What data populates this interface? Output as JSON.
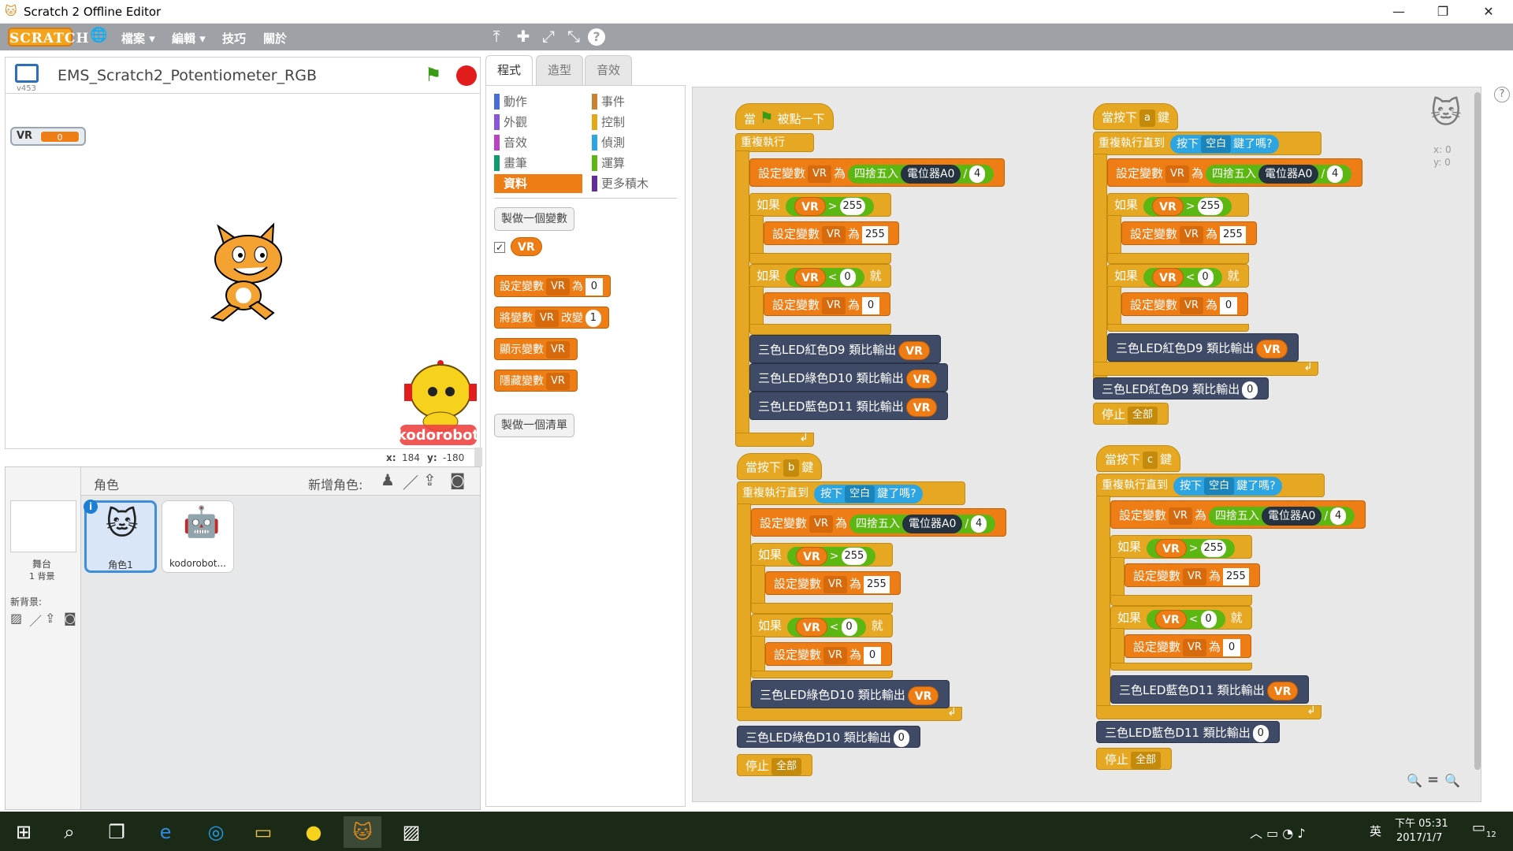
{
  "window": {
    "title": "Scratch 2 Offline Editor",
    "minimize": "—",
    "restore": "❐",
    "close": "✕"
  },
  "menu": {
    "logo": "SCRATCH",
    "globe": "🌐",
    "items": [
      "檔案 ▾",
      "編輯 ▾",
      "技巧",
      "關於"
    ]
  },
  "toolbar": {
    "duplicate": "⤒",
    "delete": "✚",
    "grow": "⤢",
    "shrink": "⤡",
    "help": "?"
  },
  "stage": {
    "project_title": "EMS_Scratch2_Potentiometer_RGB",
    "version": "v453",
    "readout_label": "VR",
    "readout_value": "0",
    "x_label": "x:",
    "x_value": "184",
    "y_label": "y:",
    "y_value": "-180"
  },
  "sprites": {
    "header": "角色",
    "new_sprite_label": "新增角色:",
    "stage_label": "舞台",
    "stage_backdrops": "1 背景",
    "new_backdrop_label": "新背景:",
    "items": [
      {
        "name": "角色1"
      },
      {
        "name": "kodorobot..."
      }
    ]
  },
  "tabs": [
    "程式",
    "造型",
    "音效"
  ],
  "categories_left": [
    "動作",
    "外觀",
    "音效",
    "畫筆",
    "資料"
  ],
  "categories_right": [
    "事件",
    "控制",
    "偵測",
    "運算",
    "更多積木"
  ],
  "category_colors": {
    "動作": "#4a6cd4",
    "外觀": "#8a55d7",
    "音效": "#bb42c3",
    "畫筆": "#0e9a6c",
    "資料": "#ee7d16",
    "事件": "#c88330",
    "控制": "#e1a91a",
    "偵測": "#2ca5e2",
    "運算": "#5cb712",
    "更多積木": "#632d99"
  },
  "palette": {
    "make_variable": "製做一個變數",
    "var_name": "VR",
    "set_block": [
      "設定變數",
      "VR",
      "為",
      "0"
    ],
    "change_block": [
      "將變數",
      "VR",
      "改變",
      "1"
    ],
    "show_block": [
      "顯示變數",
      "VR"
    ],
    "hide_block": [
      "隱藏變數",
      "VR"
    ],
    "make_list": "製做一個清單"
  },
  "script_text": {
    "when": "當",
    "clicked": "被點一下",
    "forever": "重複執行",
    "set_var": "設定變數",
    "var": "VR",
    "to": "為",
    "round": "四捨五入",
    "pot": "電位器A0",
    "div": "/",
    "four": "4",
    "if": "如果",
    "then": "就",
    "gt": ">",
    "lt": "<",
    "v255": "255",
    "v0": "0",
    "red": "三色LED紅色D9 類比輸出",
    "green": "三色LED綠色D10 類比輸出",
    "blue": "三色LED藍色D11 類比輸出",
    "when_key": "當按下",
    "key_suffix": "鍵",
    "key_a": "a",
    "key_b": "b",
    "key_c": "c",
    "repeat_until": "重複執行直到",
    "press": "按下",
    "space": "空白",
    "pressed_q": "鍵了嗎?",
    "stop": "停止",
    "all": "全部"
  },
  "script_coords": {
    "x_label": "x: 0",
    "y_label": "y: 0"
  },
  "zoom": {
    "out": "🔍",
    "reset": "=",
    "in": "🔍"
  },
  "taskbar": {
    "time": "下午 05:31",
    "date": "2017/1/7",
    "lang": "英",
    "notif": "12"
  }
}
